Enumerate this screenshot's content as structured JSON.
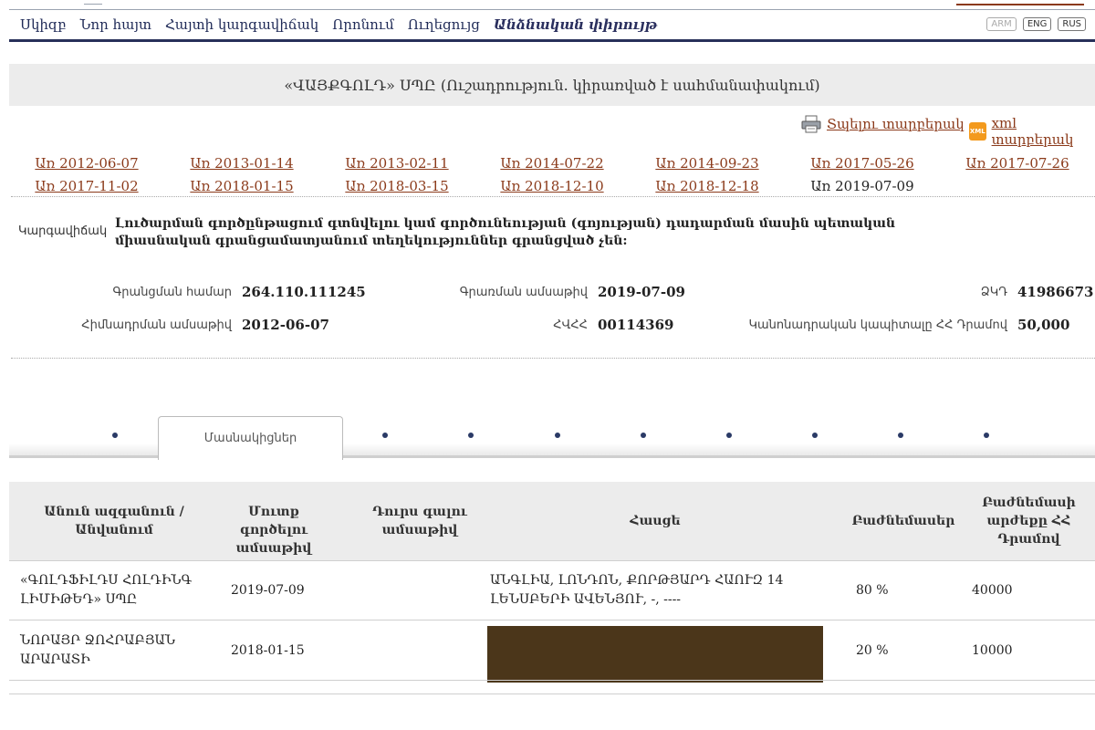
{
  "nav": {
    "items": [
      "Սկիզբ",
      "Նոր հայտ",
      "Հայտի կարգավիճակ",
      "Որոնում",
      "Ուղեցույց"
    ],
    "active": "Անձնական փիրույթ"
  },
  "languages": [
    "ARM",
    "ENG",
    "RUS"
  ],
  "page_title": "«ՎԱՅՔԳՈԼԴ» ՍՊԸ (Ուշադրություն. կիրառված է սահմանափակում)",
  "actions": {
    "print_label": "Տպելու տարբերակ",
    "xml_label": "xml տարբերակ",
    "xml_icon_text": "XML"
  },
  "versions": {
    "row1": [
      "Առ 2012-06-07",
      "Առ 2013-01-14",
      "Առ 2013-02-11",
      "Առ 2014-07-22",
      "Առ 2014-09-23",
      "Առ 2017-05-26",
      "Առ 2017-07-26"
    ],
    "row2": [
      "Առ 2017-11-02",
      "Առ 2018-01-15",
      "Առ 2018-03-15",
      "Առ 2018-12-10",
      "Առ 2018-12-18"
    ],
    "current": "Առ 2019-07-09"
  },
  "status": {
    "label": "Կարգավիճակ",
    "text": "Լուծարման գործընթացում գտնվելու կամ գործունեության (գոյության) դադարման մասին պետական միասնական գրանցամատյանում տեղեկություններ գրանցված չեն:"
  },
  "details": {
    "reg_number_label": "Գրանցման համար",
    "reg_number": "264.110.111245",
    "reg_date_label": "Գրառման ամսաթիվ",
    "reg_date": "2019-07-09",
    "tin_label": "ՁԿԴ",
    "tin": "41986673",
    "founding_date_label": "Հիմնադրման ամսաթիվ",
    "founding_date": "2012-06-07",
    "hvhh_label": "ՀՎՀՀ",
    "hvhh": "00114369",
    "capital_label": "Կանոնադրական կապիտալը ՀՀ Դրամով",
    "capital": "50,000"
  },
  "tabs": {
    "active": "Մասնակիցներ"
  },
  "table": {
    "headers": {
      "name": "Անուն ազգանուն / Անվանում",
      "entry": "Մուտք գործելու ամսաթիվ",
      "exit": "Դուրս գալու ամսաթիվ",
      "address": "Հասցե",
      "share": "Բաժնեմասեր",
      "value": "Բաժնեմասի արժեքը ՀՀ Դրամով"
    },
    "rows": [
      {
        "name": "«ԳՈԼԴՖԻԼԴՍ ՀՈԼԴԻՆԳ ԼԻՄԻԹԵԴ» ՍՊԸ",
        "entry": "2019-07-09",
        "exit": "",
        "address": "ԱՆԳԼԻԱ, ԼՈՆԴՈՆ, ՔՈՐԹՅԱՐԴ ՀԱՈՒԶ 14 ԼԵՆՍԲԵՐԻ ԱՎԵՆՅՈՒ, -, ----",
        "share": "80 %",
        "value": "40000"
      },
      {
        "name": "ՆՈՐԱՅՐ ՋՈՀՐԱԲՅԱՆ ԱՐԱՐԱՏԻ",
        "entry": "2018-01-15",
        "exit": "",
        "address": "",
        "share": "20 %",
        "value": "10000"
      }
    ]
  },
  "colors": {
    "nav_text": "#1f2a57",
    "link": "#8b3a1a",
    "nav_rule": "#27305a",
    "redaction": "#4b361a"
  }
}
